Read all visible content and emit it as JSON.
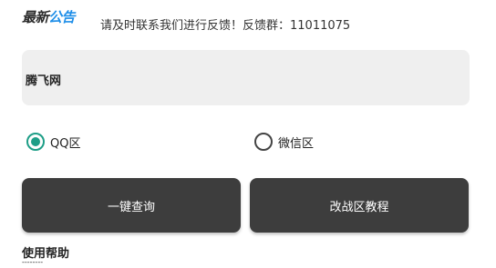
{
  "notice": {
    "badge_part1": "最新",
    "badge_part2": "公告",
    "text": "请及时联系我们进行反馈！反馈群：11011075"
  },
  "input": {
    "value": "腾飞网"
  },
  "region": {
    "options": [
      {
        "label": "QQ区",
        "checked": true
      },
      {
        "label": "微信区",
        "checked": false
      }
    ]
  },
  "buttons": {
    "query_label": "一键查询",
    "tutorial_label": "改战区教程"
  },
  "help": {
    "title": "使用帮助",
    "divider": "--------"
  },
  "colors": {
    "accent": "#1e9e87",
    "button_bg": "#3d3d3d",
    "input_bg": "#efefef",
    "badge_blue": "#1e8ee8"
  }
}
